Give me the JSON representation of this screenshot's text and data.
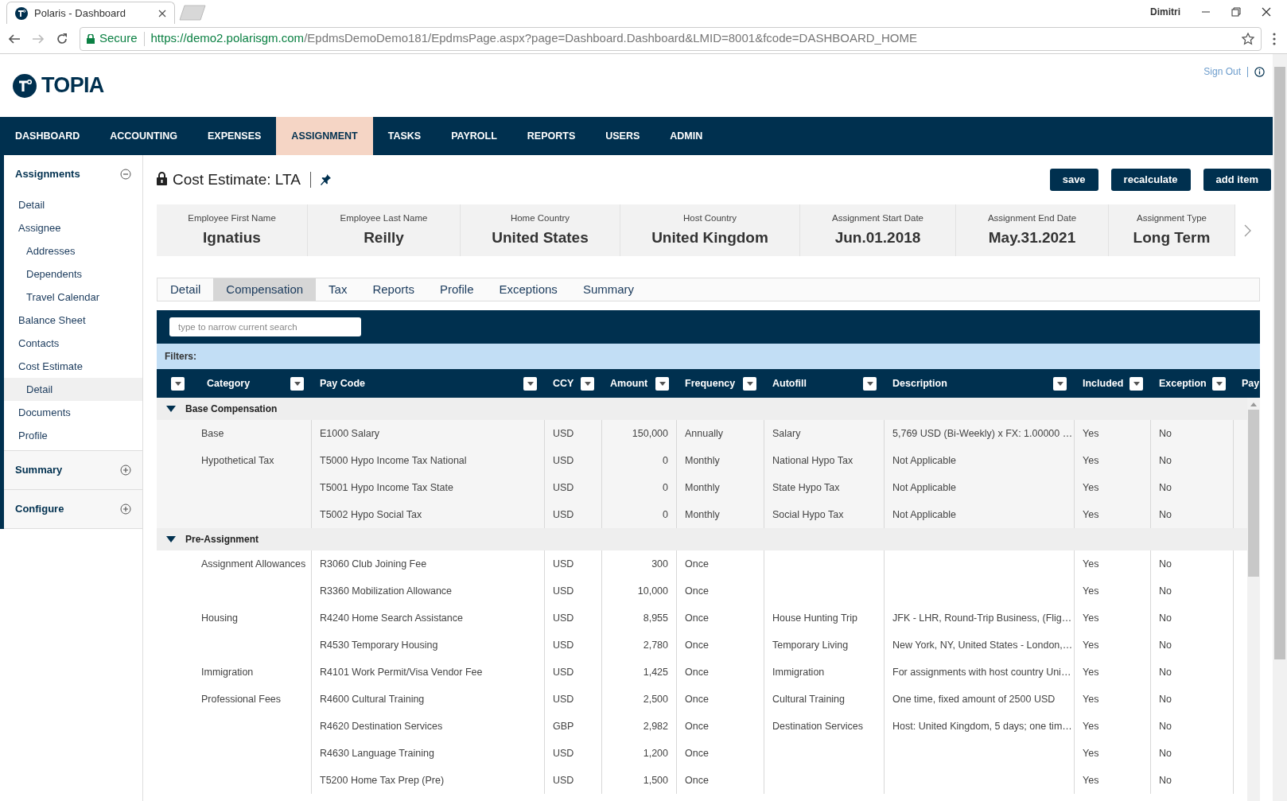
{
  "browser": {
    "tab_title": "Polaris - Dashboard",
    "user": "Dimitri",
    "secure_label": "Secure",
    "url_host": "https://demo2.polarisgm.com",
    "url_path": "/EpdmsDemoDemo181/EpdmsPage.aspx?page=Dashboard.Dashboard&LMID=8001&fcode=DASHBOARD_HOME"
  },
  "header": {
    "logo": "TOPIA",
    "sign_out": "Sign Out"
  },
  "nav": [
    {
      "label": "DASHBOARD",
      "selected": false
    },
    {
      "label": "ACCOUNTING",
      "selected": false
    },
    {
      "label": "EXPENSES",
      "selected": false
    },
    {
      "label": "ASSIGNMENT",
      "selected": true
    },
    {
      "label": "TASKS",
      "selected": false
    },
    {
      "label": "PAYROLL",
      "selected": false
    },
    {
      "label": "REPORTS",
      "selected": false
    },
    {
      "label": "USERS",
      "selected": false
    },
    {
      "label": "ADMIN",
      "selected": false
    }
  ],
  "sidebar": {
    "sections": [
      {
        "title": "Assignments",
        "expanded": true,
        "items": [
          {
            "label": "Detail",
            "selected": false
          },
          {
            "label": "Assignee",
            "selected": false,
            "children": [
              {
                "label": "Addresses",
                "selected": false
              },
              {
                "label": "Dependents",
                "selected": false
              },
              {
                "label": "Travel Calendar",
                "selected": false
              }
            ]
          },
          {
            "label": "Balance Sheet",
            "selected": false
          },
          {
            "label": "Contacts",
            "selected": false
          },
          {
            "label": "Cost Estimate",
            "selected": false,
            "children": [
              {
                "label": "Detail",
                "selected": true
              }
            ]
          },
          {
            "label": "Documents",
            "selected": false
          },
          {
            "label": "Profile",
            "selected": false
          }
        ]
      },
      {
        "title": "Summary",
        "expanded": false
      },
      {
        "title": "Configure",
        "expanded": false
      }
    ]
  },
  "page": {
    "title": "Cost Estimate: LTA",
    "buttons": [
      "save",
      "recalculate",
      "add item"
    ]
  },
  "info_cards": [
    {
      "label": "Employee First Name",
      "value": "Ignatius"
    },
    {
      "label": "Employee Last Name",
      "value": "Reilly"
    },
    {
      "label": "Home Country",
      "value": "United States"
    },
    {
      "label": "Host Country",
      "value": "United Kingdom"
    },
    {
      "label": "Assignment Start Date",
      "value": "Jun.01.2018"
    },
    {
      "label": "Assignment End Date",
      "value": "May.31.2021"
    },
    {
      "label": "Assignment Type",
      "value": "Long Term"
    }
  ],
  "tabs": [
    {
      "label": "Detail",
      "selected": false
    },
    {
      "label": "Compensation",
      "selected": true
    },
    {
      "label": "Tax",
      "selected": false
    },
    {
      "label": "Reports",
      "selected": false
    },
    {
      "label": "Profile",
      "selected": false
    },
    {
      "label": "Exceptions",
      "selected": false
    },
    {
      "label": "Summary",
      "selected": false
    }
  ],
  "search": {
    "placeholder": "type to narrow current search"
  },
  "filters_label": "Filters:",
  "table": {
    "columns": [
      {
        "filter": true
      },
      {
        "label": "Category",
        "filter": true
      },
      {
        "label": "Pay Code",
        "filter": true
      },
      {
        "label": "CCY",
        "filter": true
      },
      {
        "label": "Amount",
        "filter": true
      },
      {
        "label": "Frequency",
        "filter": true
      },
      {
        "label": "Autofill",
        "filter": true
      },
      {
        "label": "Description",
        "filter": true
      },
      {
        "label": "Included",
        "filter": true
      },
      {
        "label": "Exception",
        "filter": true
      },
      {
        "label": "Pay",
        "filter": false
      }
    ],
    "groups": [
      {
        "label": "Base Compensation",
        "expanded": true,
        "shaded": true,
        "rows": [
          {
            "category": "Base",
            "pay_code": "E1000 Salary",
            "ccy": "USD",
            "amount": "150,000",
            "frequency": "Annually",
            "autofill": "Salary",
            "description": "5,769 USD (Bi-Weekly) x FX: 1.00000 …",
            "included": "Yes",
            "exception": "No"
          },
          {
            "category": "Hypothetical Tax",
            "pay_code": "T5000 Hypo Income Tax National",
            "ccy": "USD",
            "amount": "0",
            "frequency": "Monthly",
            "autofill": "National Hypo Tax",
            "description": "Not Applicable",
            "included": "Yes",
            "exception": "No"
          },
          {
            "pay_code": "T5001 Hypo Income Tax State",
            "ccy": "USD",
            "amount": "0",
            "frequency": "Monthly",
            "autofill": "State Hypo Tax",
            "description": "Not Applicable",
            "included": "Yes",
            "exception": "No"
          },
          {
            "pay_code": "T5002 Hypo Social Tax",
            "ccy": "USD",
            "amount": "0",
            "frequency": "Monthly",
            "autofill": "Social Hypo Tax",
            "description": "Not Applicable",
            "included": "Yes",
            "exception": "No"
          }
        ]
      },
      {
        "label": "Pre-Assignment",
        "expanded": true,
        "shaded": false,
        "rows": [
          {
            "category": "Assignment Allowances",
            "pay_code": "R3060 Club Joining Fee",
            "ccy": "USD",
            "amount": "300",
            "frequency": "Once",
            "included": "Yes",
            "exception": "No"
          },
          {
            "pay_code": "R3360 Mobilization Allowance",
            "ccy": "USD",
            "amount": "10,000",
            "frequency": "Once",
            "included": "Yes",
            "exception": "No"
          },
          {
            "category": "Housing",
            "pay_code": "R4240 Home Search Assistance",
            "ccy": "USD",
            "amount": "8,955",
            "frequency": "Once",
            "autofill": "House Hunting Trip",
            "description": "JFK - LHR, Round-Trip Business, (Flig…",
            "included": "Yes",
            "exception": "No"
          },
          {
            "pay_code": "R4530 Temporary Housing",
            "ccy": "USD",
            "amount": "2,780",
            "frequency": "Once",
            "autofill": "Temporary Living",
            "description": "New York, NY, United States - London,…",
            "included": "Yes",
            "exception": "No"
          },
          {
            "category": "Immigration",
            "pay_code": "R4101 Work Permit/Visa Vendor Fee",
            "ccy": "USD",
            "amount": "1,425",
            "frequency": "Once",
            "autofill": "Immigration",
            "description": "For assignments with host country Uni…",
            "included": "Yes",
            "exception": "No"
          },
          {
            "category": "Professional Fees",
            "pay_code": "R4600 Cultural Training",
            "ccy": "USD",
            "amount": "2,500",
            "frequency": "Once",
            "autofill": "Cultural Training",
            "description": "One time, fixed amount of 2500 USD",
            "included": "Yes",
            "exception": "No"
          },
          {
            "pay_code": "R4620 Destination Services",
            "ccy": "GBP",
            "amount": "2,982",
            "frequency": "Once",
            "autofill": "Destination Services",
            "description": "Host: United Kingdom, 5 days; one tim…",
            "included": "Yes",
            "exception": "No"
          },
          {
            "pay_code": "R4630 Language Training",
            "ccy": "USD",
            "amount": "1,200",
            "frequency": "Once",
            "included": "Yes",
            "exception": "No"
          },
          {
            "pay_code": "T5200 Home Tax Prep (Pre)",
            "ccy": "USD",
            "amount": "1,500",
            "frequency": "Once",
            "included": "Yes",
            "exception": "No"
          }
        ]
      }
    ]
  }
}
